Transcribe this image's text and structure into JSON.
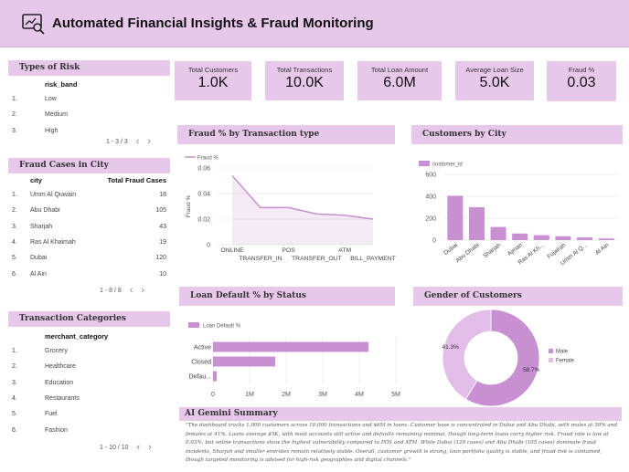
{
  "header": {
    "title": "Automated Financial Insights & Fraud Monitoring",
    "icon": "analytics-magnifier-icon"
  },
  "risk": {
    "title": "Types of Risk",
    "column": "risk_band",
    "rows": [
      {
        "idx": "1.",
        "label": "Low"
      },
      {
        "idx": "2.",
        "label": "Medium"
      },
      {
        "idx": "3.",
        "label": "High"
      }
    ],
    "pager": "1 - 3 / 3"
  },
  "fraud_city": {
    "title": "Fraud Cases in City",
    "col_city": "city",
    "col_total": "Total Fraud Cases",
    "rows": [
      {
        "idx": "1.",
        "label": "Umm Al Quwain",
        "value": "18"
      },
      {
        "idx": "2.",
        "label": "Abu Dhabi",
        "value": "105"
      },
      {
        "idx": "3.",
        "label": "Sharjah",
        "value": "43"
      },
      {
        "idx": "4.",
        "label": "Ras Al Khaimah",
        "value": "19"
      },
      {
        "idx": "5.",
        "label": "Dubai",
        "value": "120"
      },
      {
        "idx": "6.",
        "label": "Al Ain",
        "value": "10"
      }
    ],
    "pager": "1 - 8 / 8"
  },
  "txn_categories": {
    "title": "Transaction Categories",
    "column": "merchant_category",
    "rows": [
      {
        "idx": "1.",
        "label": "Grocery"
      },
      {
        "idx": "2.",
        "label": "Healthcare"
      },
      {
        "idx": "3.",
        "label": "Education"
      },
      {
        "idx": "4.",
        "label": "Restaurants"
      },
      {
        "idx": "5.",
        "label": "Fuel"
      },
      {
        "idx": "6.",
        "label": "Fashion"
      }
    ],
    "pager": "1 - 10 / 10"
  },
  "kpis": [
    {
      "label": "Total Customers",
      "value": "1.0K"
    },
    {
      "label": "Total Transactions",
      "value": "10.0K"
    },
    {
      "label": "Total Loan Amount",
      "value": "6.0M"
    },
    {
      "label": "Average Loan Size",
      "value": "5.0K"
    },
    {
      "label": "Fraud %",
      "value": "0.03"
    }
  ],
  "colors": {
    "accent": "#e7c8ea",
    "series": "#c98fd3",
    "series_light": "#e2bde7"
  },
  "chart_data": [
    {
      "id": "fraud_by_type",
      "type": "line",
      "title": "Fraud % by Transaction type",
      "legend": "Fraud %",
      "ylabel": "Fraud %",
      "categories": [
        "ONLINE",
        "TRANSFER_IN",
        "POS",
        "TRANSFER_OUT",
        "ATM",
        "BILL_PAYMENT"
      ],
      "values": [
        0.054,
        0.029,
        0.029,
        0.024,
        0.023,
        0.02
      ],
      "ylim": [
        0,
        0.06
      ],
      "yticks": [
        "0",
        "0.02",
        "0.04",
        "0.06"
      ]
    },
    {
      "id": "customers_by_city",
      "type": "bar",
      "title": "Customers by City",
      "legend": "customer_id",
      "categories": [
        "Dubai",
        "Abu Dhabi",
        "Sharjah",
        "Ajman",
        "Ras Al Kh...",
        "Fujairah",
        "Umm Al Q...",
        "Al Ain"
      ],
      "values": [
        405,
        300,
        120,
        60,
        45,
        35,
        25,
        15
      ],
      "ylim": [
        0,
        600
      ],
      "yticks": [
        "0",
        "200",
        "400",
        "600"
      ]
    },
    {
      "id": "loan_default_by_status",
      "type": "bar",
      "orientation": "horizontal",
      "title": "Loan Default % by Status",
      "legend": "Loan Default %",
      "categories": [
        "Active",
        "Closed",
        "Defau..."
      ],
      "values": [
        4250000,
        1700000,
        100000
      ],
      "xlim": [
        0,
        5000000
      ],
      "xticks": [
        "0",
        "1M",
        "2M",
        "3M",
        "4M",
        "5M"
      ]
    },
    {
      "id": "gender_of_customers",
      "type": "pie",
      "title": "Gender of Customers",
      "labels": [
        "Male",
        "Female"
      ],
      "values": [
        58.7,
        41.3
      ],
      "value_labels": [
        "58.7%",
        "41.3%"
      ],
      "colors": [
        "#c98fd3",
        "#e2bde7"
      ]
    }
  ],
  "summary": {
    "title": "AI Gemini Summary",
    "text": "\"The dashboard tracks 1,000 customers across 10,000 transactions and $6M in loans. Customer base is concentrated in Dubai and Abu Dhabi, with males at 59% and females at 41%. Loans average $5K, with most accounts still active and defaults remaining minimal, though long-term loans carry higher risk. Fraud rate is low at 0.03%, but online transactions show the highest vulnerability compared to POS and ATM. While Dubai (120 cases) and Abu Dhabi (105 cases) dominate fraud incidents, Sharjah and smaller emirates remain relatively stable. Overall, customer growth is strong, loan portfolio quality is stable, and fraud risk is contained, though targeted monitoring is advised for high-risk geographies and digital channels.\""
  }
}
